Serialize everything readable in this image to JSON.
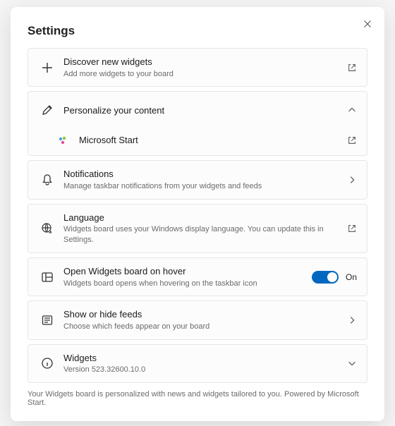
{
  "header": {
    "title": "Settings"
  },
  "rows": {
    "discover": {
      "title": "Discover new widgets",
      "sub": "Add more widgets to your board"
    },
    "personalize": {
      "title": "Personalize your content"
    },
    "msstart": {
      "title": "Microsoft Start"
    },
    "notifications": {
      "title": "Notifications",
      "sub": "Manage taskbar notifications from your widgets and feeds"
    },
    "language": {
      "title": "Language",
      "sub": "Widgets board uses your Windows display language. You can update this in Settings."
    },
    "hover": {
      "title": "Open Widgets board on hover",
      "sub": "Widgets board opens when hovering on the taskbar icon",
      "toggle_label": "On"
    },
    "feeds": {
      "title": "Show or hide feeds",
      "sub": "Choose which feeds appear on your board"
    },
    "widgets": {
      "title": "Widgets",
      "sub": "Version 523.32600.10.0"
    }
  },
  "footer": "Your Widgets board is personalized with news and widgets tailored to you. Powered by Microsoft Start."
}
